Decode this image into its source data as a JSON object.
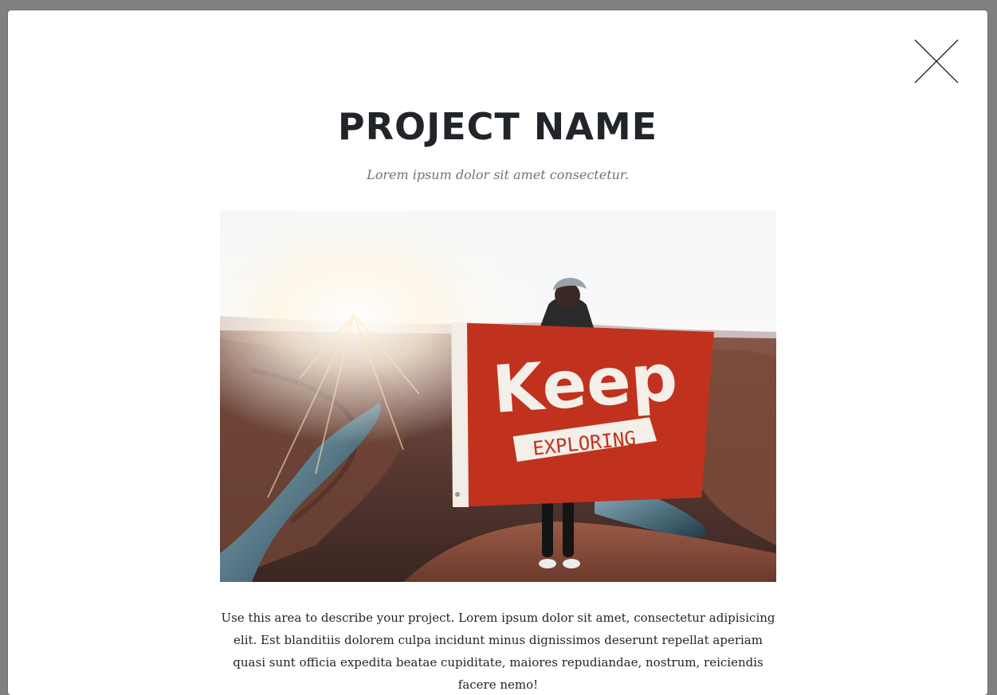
{
  "modal": {
    "title": "PROJECT NAME",
    "subtitle": "Lorem ipsum dolor sit amet consectetur.",
    "description": "Use this area to describe your project. Lorem ipsum dolor sit amet, consectetur adipisicing elit. Est blanditiis dolorem culpa incidunt minus dignissimos deserunt repellat aperiam quasi sunt officia expedita beatae cupiditate, maiores repudiandae, nostrum, reiciendis facere nemo!",
    "close_icon": "close-icon"
  },
  "image": {
    "flag_text_main": "Keep",
    "flag_text_banner": "EXPLORING",
    "flag_color": "#c0321e"
  },
  "colors": {
    "overlay": "#808080",
    "heading": "#212529",
    "muted": "#6c757d"
  }
}
